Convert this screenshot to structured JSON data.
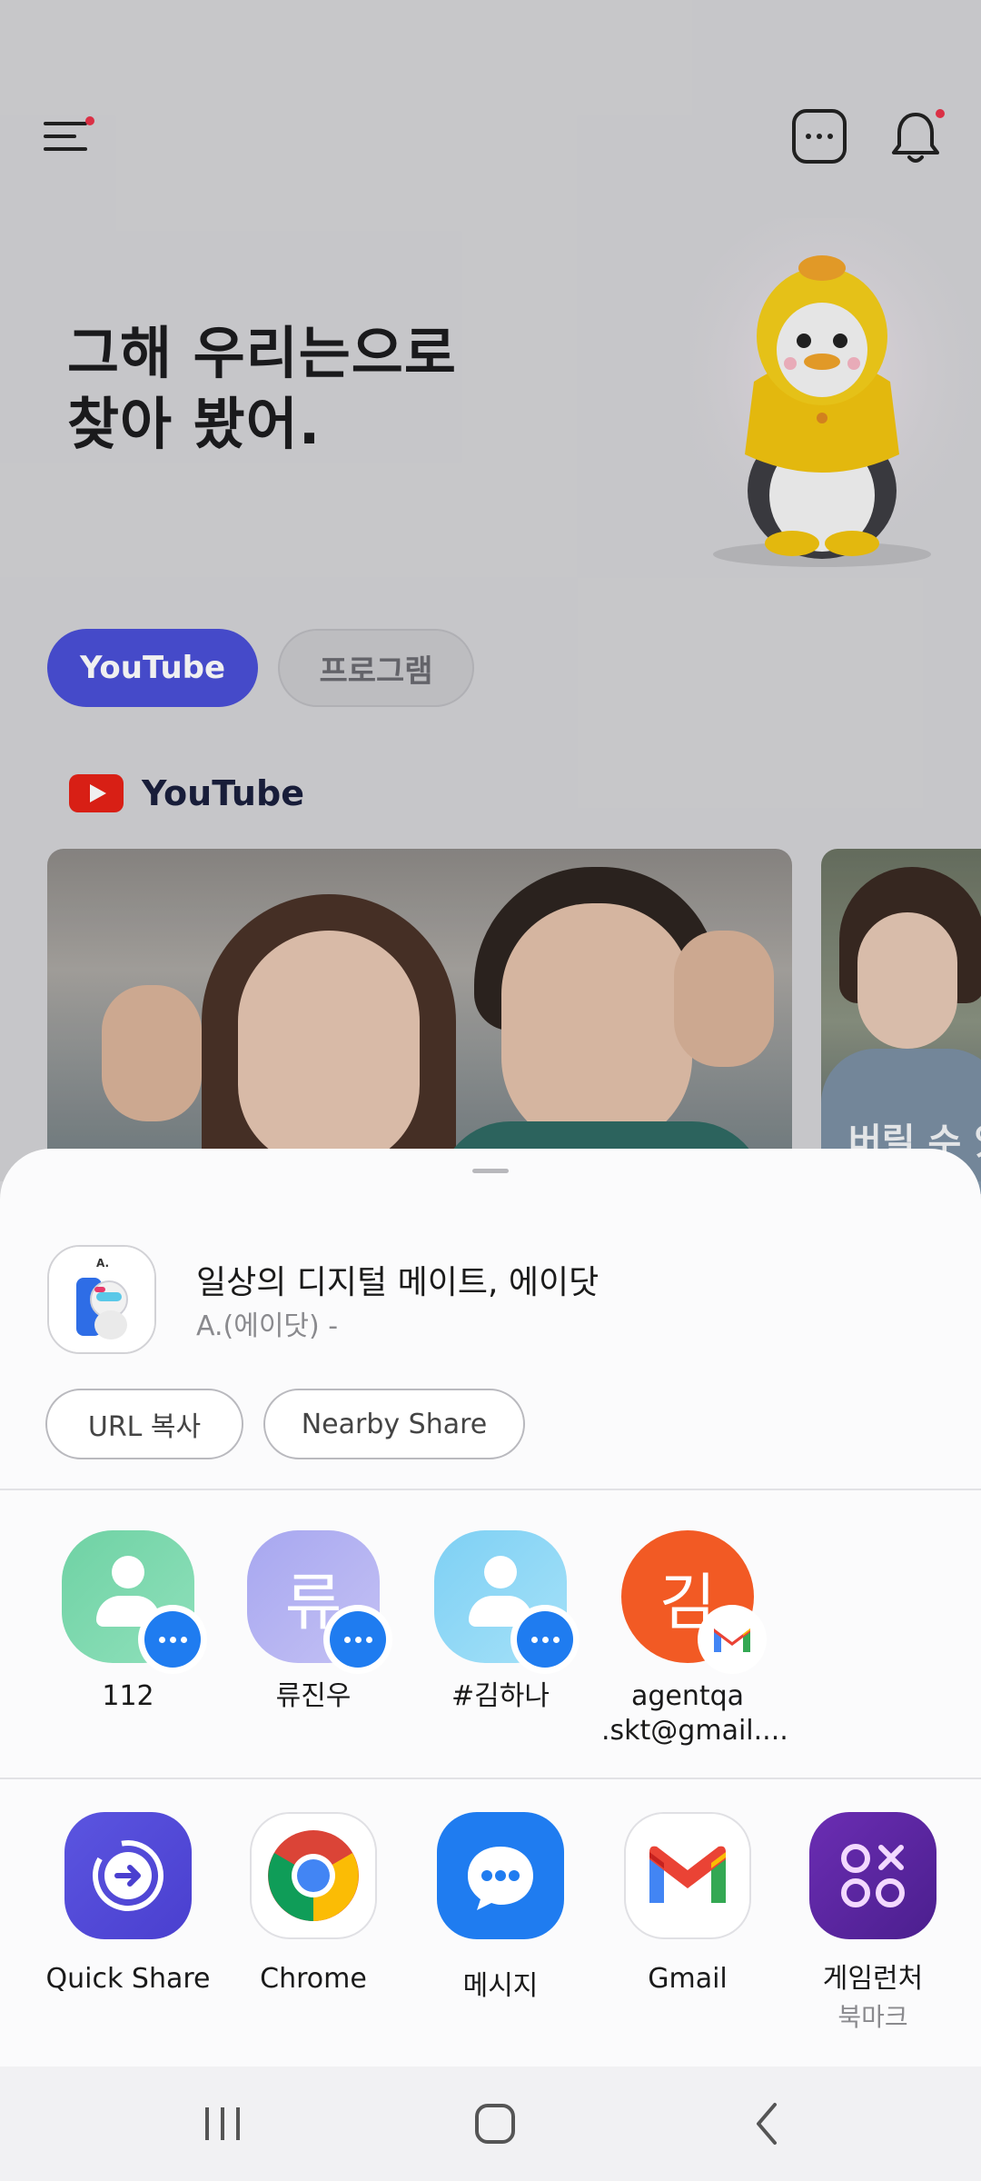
{
  "header": {
    "menu_icon": "hamburger-menu-icon",
    "chat_icon": "chat-more-icon",
    "bell_icon": "notification-bell-icon"
  },
  "hero": {
    "title_line1": "그해 우리는으로",
    "title_line2": "찾아 봤어."
  },
  "chips": {
    "youtube": "YouTube",
    "program": "프로그램"
  },
  "section": {
    "title": "YouTube"
  },
  "videos": [
    {
      "caption": ""
    },
    {
      "caption": "버릴 수 있"
    }
  ],
  "share_sheet": {
    "preview_title": "일상의 디지털 메이트, 에이닷",
    "preview_subtitle": "A.(에이닷) -",
    "url_copy": "URL 복사",
    "nearby_share": "Nearby Share",
    "contacts": [
      {
        "name": "112",
        "badge": "messages-icon"
      },
      {
        "name": "류진우",
        "initial": "류",
        "badge": "messages-icon"
      },
      {
        "name": "#김하나",
        "badge": "messages-icon"
      },
      {
        "name_line1": "agentqa",
        "name_line2": ".skt@gmail....",
        "initial": "김",
        "badge": "gmail-icon"
      }
    ],
    "apps": [
      {
        "label": "Quick Share"
      },
      {
        "label": "Chrome"
      },
      {
        "label": "메시지"
      },
      {
        "label": "Gmail"
      },
      {
        "label": "게임런처",
        "sublabel": "북마크"
      }
    ]
  },
  "colors": {
    "accent": "#4a4fd6",
    "youtube_red": "#e62117",
    "notification_dot": "#e8334a",
    "messages_blue": "#1f7cf0"
  }
}
